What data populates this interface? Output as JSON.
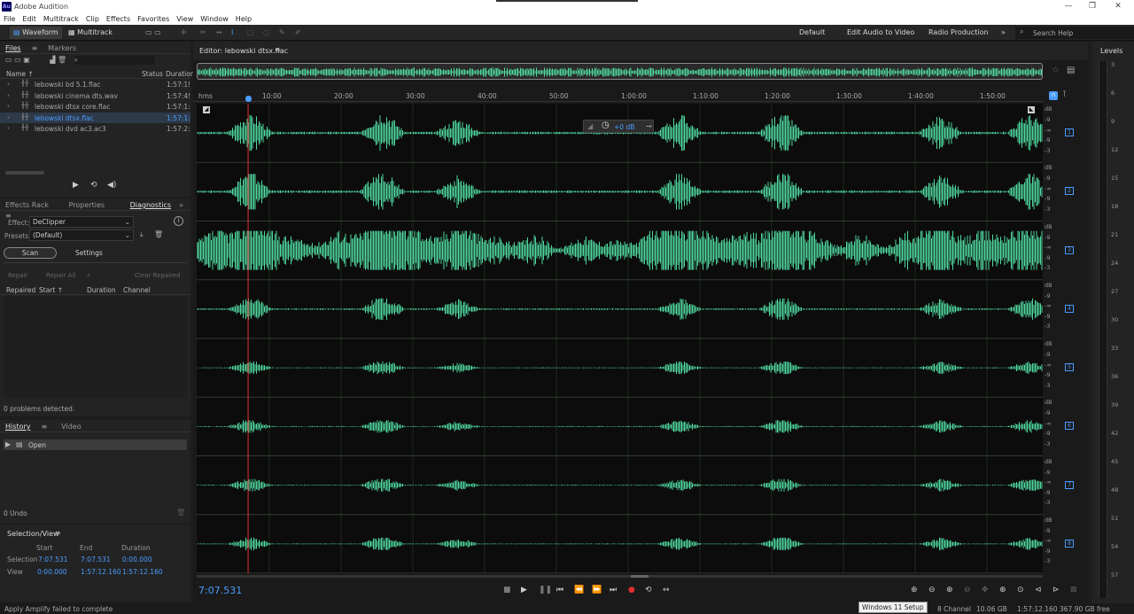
{
  "app": {
    "title": "Adobe Audition",
    "logo": "Au"
  },
  "menu": [
    "File",
    "Edit",
    "Multitrack",
    "Clip",
    "Effects",
    "Favorites",
    "View",
    "Window",
    "Help"
  ],
  "toolbar": {
    "waveform": "Waveform",
    "multitrack": "Multitrack",
    "workspaces": [
      "Default",
      "Edit Audio to Video",
      "Radio Production"
    ],
    "search_placeholder": "Search Help"
  },
  "files": {
    "tabs": [
      "Files",
      "Markers"
    ],
    "columns": {
      "name": "Name ↑",
      "status": "Status",
      "duration": "Duration"
    },
    "items": [
      {
        "name": "lebowski bd 5.1.flac",
        "duration": "1:57:1!",
        "selected": false
      },
      {
        "name": "lebowski cinema dts.wav",
        "duration": "1:57:4!",
        "selected": false
      },
      {
        "name": "lebowski dtsx core.flac",
        "duration": "1:57:1:",
        "selected": false
      },
      {
        "name": "lebowski dtsx.flac",
        "duration": "1:57:1:",
        "selected": true
      },
      {
        "name": "lebowski dvd ac3.ac3",
        "duration": "1:57:2:",
        "selected": false
      }
    ]
  },
  "diagnostics": {
    "tabs": [
      "Effects Rack",
      "Properties",
      "Diagnostics"
    ],
    "effect_label": "Effect:",
    "effect_value": "DeClipper",
    "presets_label": "Presets:",
    "presets_value": "(Default)",
    "scan": "Scan",
    "settings": "Settings",
    "repair": "Repair",
    "repair_all": "Repair All",
    "clear_repaired": "Clear Repaired",
    "columns": [
      "Repaired",
      "Start ↑",
      "Duration",
      "Channel"
    ],
    "status": "0 problems detected."
  },
  "history": {
    "tabs": [
      "History",
      "Video"
    ],
    "items": [
      "Open"
    ],
    "undo": "0 Undo"
  },
  "selection_view": {
    "title": "Selection/View",
    "headers": [
      "Start",
      "End",
      "Duration"
    ],
    "rows": [
      {
        "label": "Selection",
        "start": "7:07.531",
        "end": "7:07.531",
        "duration": "0:00.000"
      },
      {
        "label": "View",
        "start": "0:00.000",
        "end": "1:57:12.160",
        "duration": "1:57:12.160"
      }
    ]
  },
  "editor": {
    "title": "Editor: lebowski dtsx.flac",
    "timecode": "7:07.531",
    "hms": "hms",
    "ruler": [
      "10:00",
      "20:00",
      "30:00",
      "40:00",
      "50:00",
      "1:00:00",
      "1:10:00",
      "1:20:00",
      "1:30:00",
      "1:40:00",
      "1:50:00"
    ],
    "hud_gain": "+0 dB",
    "db_unit": "dB",
    "db_ticks": [
      "-9",
      "-∞",
      "-9",
      "-3"
    ],
    "channels": [
      "1",
      "2",
      "3",
      "4",
      "5",
      "6",
      "7",
      "8"
    ],
    "playhead_fraction": 0.0608
  },
  "levels": {
    "title": "Levels",
    "scale": [
      "3",
      "6",
      "9",
      "12",
      "15",
      "18",
      "21",
      "24",
      "27",
      "30",
      "33",
      "36",
      "39",
      "42",
      "45",
      "48",
      "51",
      "54",
      "57"
    ]
  },
  "status": {
    "left": "Apply Amplify failed to complete",
    "tooltip": "Windows 11 Setup",
    "channel": "8 Channel",
    "size": "10.06 GB",
    "duration": "1:57:12.160",
    "free": "367.90 GB free"
  },
  "colors": {
    "accent": "#4a9cff",
    "wave": "#4fd8a0",
    "playhead": "#e03030"
  }
}
